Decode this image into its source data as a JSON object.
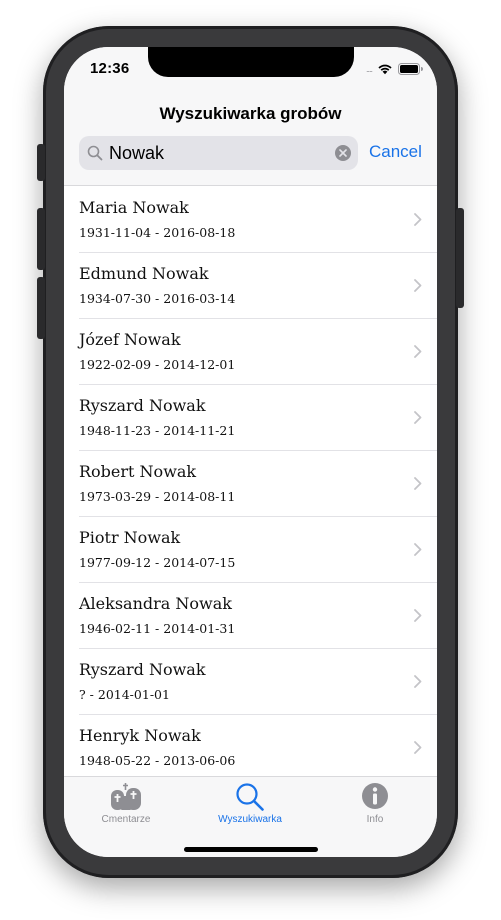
{
  "status_bar": {
    "time": "12:36",
    "signal": "....",
    "icons": [
      "wifi-icon",
      "battery-icon"
    ]
  },
  "header": {
    "title": "Wyszukiwarka grobów"
  },
  "search": {
    "value": "Nowak",
    "placeholder": "",
    "cancel_label": "Cancel"
  },
  "results": [
    {
      "name": "Maria Nowak",
      "dates": "1931-11-04 - 2016-08-18"
    },
    {
      "name": "Edmund Nowak",
      "dates": "1934-07-30 - 2016-03-14"
    },
    {
      "name": "Józef Nowak",
      "dates": "1922-02-09 - 2014-12-01"
    },
    {
      "name": "Ryszard Nowak",
      "dates": "1948-11-23 - 2014-11-21"
    },
    {
      "name": "Robert Nowak",
      "dates": "1973-03-29 - 2014-08-11"
    },
    {
      "name": "Piotr Nowak",
      "dates": "1977-09-12 - 2014-07-15"
    },
    {
      "name": "Aleksandra Nowak",
      "dates": "1946-02-11 - 2014-01-31"
    },
    {
      "name": "Ryszard Nowak",
      "dates": "? - 2014-01-01"
    },
    {
      "name": "Henryk Nowak",
      "dates": "1948-05-22 - 2013-06-06"
    }
  ],
  "tab_bar": {
    "tabs": [
      {
        "label": "Cmentarze",
        "icon": "cemetery-icon",
        "selected": false
      },
      {
        "label": "Wyszukiwarka",
        "icon": "search-icon",
        "selected": true
      },
      {
        "label": "Info",
        "icon": "info-icon",
        "selected": false
      }
    ]
  },
  "colors": {
    "accent": "#1a73e8",
    "inactive": "#8e8e93",
    "bar_background": "#f7f7f8",
    "frame": "#3a3a3c"
  }
}
